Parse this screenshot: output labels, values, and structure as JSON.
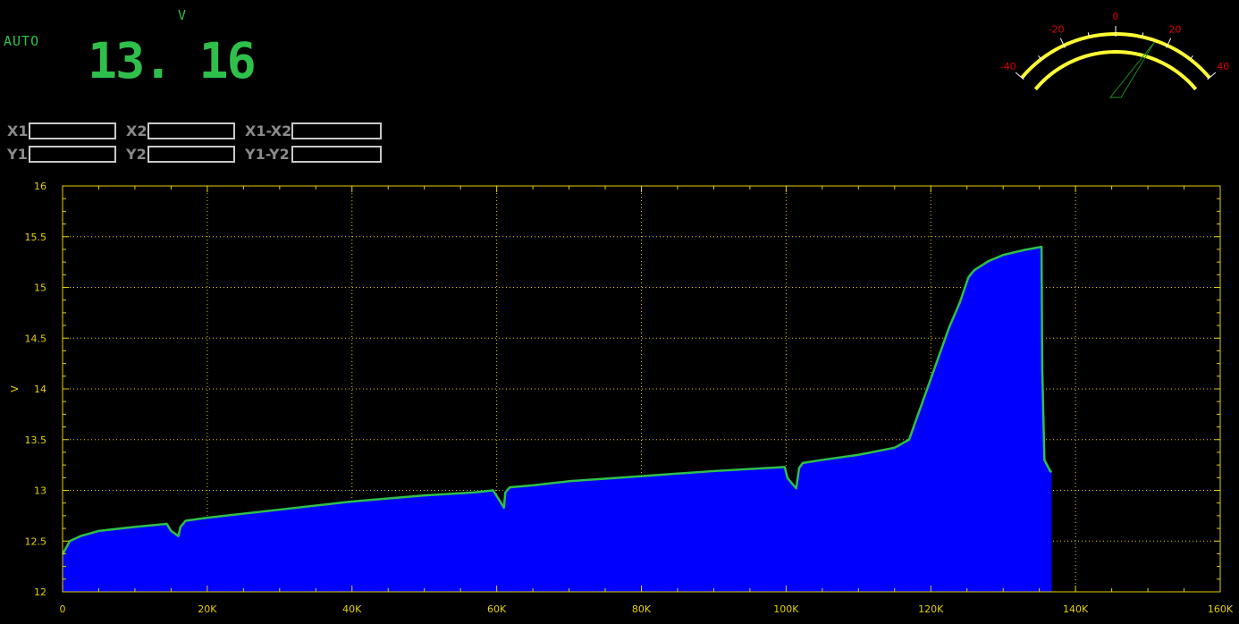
{
  "meter": {
    "mode": "AUTO",
    "unit": "V",
    "reading": "13. 16"
  },
  "cursors": {
    "x1": {
      "label": "X1",
      "value": ""
    },
    "x2": {
      "label": "X2",
      "value": ""
    },
    "dx": {
      "label": "X1-X2",
      "value": ""
    },
    "y1": {
      "label": "Y1",
      "value": ""
    },
    "y2": {
      "label": "Y2",
      "value": ""
    },
    "dy": {
      "label": "Y1-Y2",
      "value": ""
    }
  },
  "gauge": {
    "scale_labels": [
      "-40",
      "-20",
      "0",
      "20",
      "40"
    ],
    "needle_value": 15,
    "colors": {
      "arc": "#ffff33",
      "numbers": "#e00000",
      "needle": "#1e8c1e"
    }
  },
  "colors": {
    "fill": "#0000ff",
    "line": "#2ec04a",
    "axis_text": "#e6d000",
    "grid": "#e6d000"
  },
  "chart_data": {
    "type": "area",
    "ylabel": "V",
    "xlim": [
      0,
      160000
    ],
    "ylim": [
      12,
      16
    ],
    "x_ticks": [
      0,
      20000,
      40000,
      60000,
      80000,
      100000,
      120000,
      140000,
      160000
    ],
    "x_tick_labels": [
      "0",
      "20K",
      "40K",
      "60K",
      "80K",
      "100K",
      "120K",
      "140K",
      "160K"
    ],
    "y_ticks": [
      12,
      12.5,
      13,
      13.5,
      14,
      14.5,
      15,
      15.5,
      16
    ],
    "y_tick_labels": [
      "12",
      "12.5",
      "13",
      "13.5",
      "14",
      "14.5",
      "15",
      "15.5",
      "16"
    ],
    "grid": true,
    "series": [
      {
        "x": [
          0,
          1000,
          2500,
          5000,
          10000,
          14400,
          15000,
          16000,
          16300,
          17000,
          20000,
          30000,
          40000,
          50000,
          57000,
          59500,
          60400,
          61000,
          61200,
          61800,
          65000,
          70000,
          80000,
          90000,
          99800,
          100200,
          101400,
          101800,
          102300,
          105000,
          110000,
          115000,
          117000,
          118500,
          120000,
          121000,
          122500,
          124000,
          125200,
          126000,
          128000,
          130000,
          133000,
          135300,
          135400,
          135700,
          136500,
          136700
        ],
        "y": [
          12.37,
          12.5,
          12.55,
          12.6,
          12.64,
          12.67,
          12.6,
          12.55,
          12.64,
          12.7,
          12.73,
          12.81,
          12.89,
          12.95,
          12.98,
          13.0,
          12.9,
          12.83,
          12.98,
          13.03,
          13.05,
          13.09,
          13.14,
          13.19,
          13.23,
          13.12,
          13.02,
          13.22,
          13.27,
          13.3,
          13.35,
          13.42,
          13.5,
          13.8,
          14.1,
          14.3,
          14.6,
          14.85,
          15.1,
          15.17,
          15.26,
          15.32,
          15.37,
          15.4,
          14.2,
          13.3,
          13.19,
          13.18
        ]
      }
    ]
  }
}
